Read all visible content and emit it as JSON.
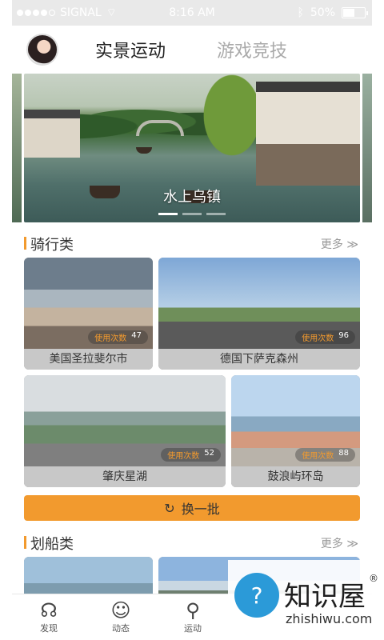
{
  "status_bar": {
    "carrier": "SIGNAL",
    "time": "8:16 AM",
    "battery": "50%"
  },
  "header": {
    "tabs": [
      {
        "label": "实景运动"
      },
      {
        "label": "游戏竞技"
      }
    ]
  },
  "banner": {
    "caption": "水上乌镇"
  },
  "cycling": {
    "title": "骑行类",
    "more": "更多 ≫",
    "usage_label": "使用次数",
    "cards": [
      {
        "name": "美国圣拉斐尔市",
        "count": "47"
      },
      {
        "name": "德国下萨克森州",
        "count": "96"
      },
      {
        "name": "肇庆星湖",
        "count": "52"
      },
      {
        "name": "鼓浪屿环岛",
        "count": "88"
      }
    ],
    "refresh": "换一批"
  },
  "rowing": {
    "title": "划船类",
    "more": "更多 ≫"
  },
  "tabbar": {
    "items": [
      {
        "label": "发现"
      },
      {
        "label": "动态"
      },
      {
        "label": "运动"
      }
    ]
  },
  "watermark": {
    "brand": "知识屋",
    "domain": "zhishiwu.com",
    "reg": "®"
  }
}
